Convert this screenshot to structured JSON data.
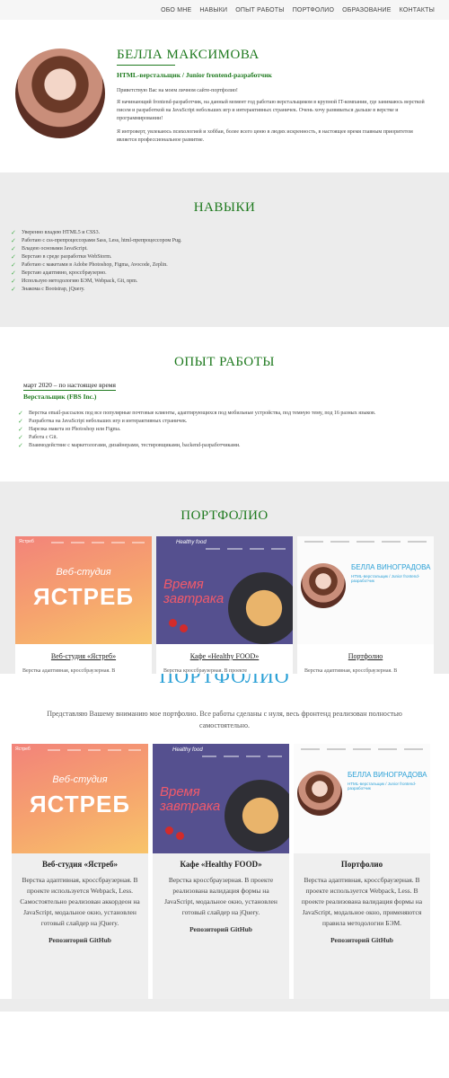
{
  "nav": {
    "items": [
      "ОБО МНЕ",
      "НАВЫКИ",
      "ОПЫТ РАБОТЫ",
      "ПОРТФОЛИО",
      "ОБРАЗОВАНИЕ",
      "КОНТАКТЫ"
    ]
  },
  "hero": {
    "name": "БЕЛЛА МАКСИМОВА",
    "role": "HTML-верстальщик / Junior frontend-разработчик",
    "p1": "Приветствую Вас на моем личном сайте-портфолио!",
    "p2": "Я начинающий frontend-разработчик, на данный момент год работаю верстальщиком в крупной IT-компании, где занимаюсь версткой писем и разработкой на JavaScript небольших игр и интерактивных страничек. Очень хочу развиваться дальше в верстке и программировании!",
    "p3": "Я интроверт, увлекаюсь психологией и хоббаи, более всего ценю в людях искренность, в настоящее время главным приоритетом является профессиональное развитие."
  },
  "skills": {
    "title": "НАВЫКИ",
    "items": [
      "Уверенно владею HTML5 и CSS3.",
      "Работаю с css-препроцессорами Sass, Less, html-препроцессором Pug.",
      "Владею основами JavaScript.",
      "Верстаю в среде разработки WebStorm.",
      "Работаю с макетами в Adobe Photoshop, Figma, Avocode, Zeplin.",
      "Верстаю адаптивно, кроссбраузерно.",
      "Использую методологию БЭМ, Webpack, Git, npm.",
      "Знакома с Bootstrap, jQuery."
    ]
  },
  "experience": {
    "title": "ОПЫТ РАБОТЫ",
    "period": "март 2020 – по настоящее время",
    "position": "Верстальщик (FBS Inc.)",
    "items": [
      "Верстка email-рассылок под все популярные почтовые клиенты, адаптирующихся под мобильные устройства, под темную тему, под 16 разных языков.",
      "Разработка на JavaScript небольших игр и интерактивных страничек.",
      "Нарезка макета из Photoshop или Figma.",
      "Работа с Git.",
      "Взаимодействие с маркетологами, дизайнерами, тестировщиками, backend-разработчиками."
    ]
  },
  "portfolio": {
    "title": "ПОРТФОЛИО",
    "cards": [
      {
        "title": "Веб-студия «Ястреб»",
        "desc": "Верстка адаптивная, кроссбраузерная. В",
        "thumb_top": "Веб-студия",
        "thumb_main": "ЯСТРЕБ",
        "brand": "Ястреб"
      },
      {
        "title": "Кафе «Healthy FOOD»",
        "desc": "Верстка кроссбраузерная. В проекте",
        "thumb_main": "Время завтрака",
        "brand": "Healthy food"
      },
      {
        "title": "Портфолио",
        "desc": "Верстка адаптивная, кроссбраузерная. В",
        "thumb_name": "БЕЛЛА ВИНОГРАДОВА",
        "thumb_role": "HTML-верстальщик / Junior frontend-разработчик"
      }
    ]
  },
  "portfolio2": {
    "title": "ПОРТФОЛИО",
    "intro": "Представляю Вашему вниманию мое портфолио. Все работы сделаны с нуля, весь фронтенд реализован полностью самостоятельно.",
    "cards": [
      {
        "title": "Веб-студия «Ястреб»",
        "desc": "Верстка адаптивная, кроссбраузерная. В проекте используется Webpack, Less. Самостоятельно реализован аккордеон на JavaScript, модальное окно, установлен готовый слайдер на jQuery.",
        "repo": "Репозиторий GitHub",
        "thumb_top": "Веб-студия",
        "thumb_main": "ЯСТРЕБ",
        "brand": "Ястреб"
      },
      {
        "title": "Кафе «Healthy FOOD»",
        "desc": "Верстка кроссбраузерная. В проекте реализована валидация формы на JavaScript, модальное окно, установлен готовый слайдер на jQuery.",
        "repo": "Репозиторий GitHub",
        "thumb_main": "Время завтрака",
        "brand": "Healthy food"
      },
      {
        "title": "Портфолио",
        "desc": "Верстка адаптивная, кроссбраузерная. В проекте используется Webpack, Less. В проекте реализована валидация формы на JavaScript, модальное окно, применяются правила методологии БЭМ.",
        "repo": "Репозиторий GitHub",
        "thumb_name": "БЕЛЛА ВИНОГРАДОВА",
        "thumb_role": "HTML-верстальщик / Junior frontend-разработчик"
      }
    ]
  },
  "colors": {
    "accent": "#1f7a1f",
    "check": "#4caf50",
    "section_bg": "#ececec"
  }
}
